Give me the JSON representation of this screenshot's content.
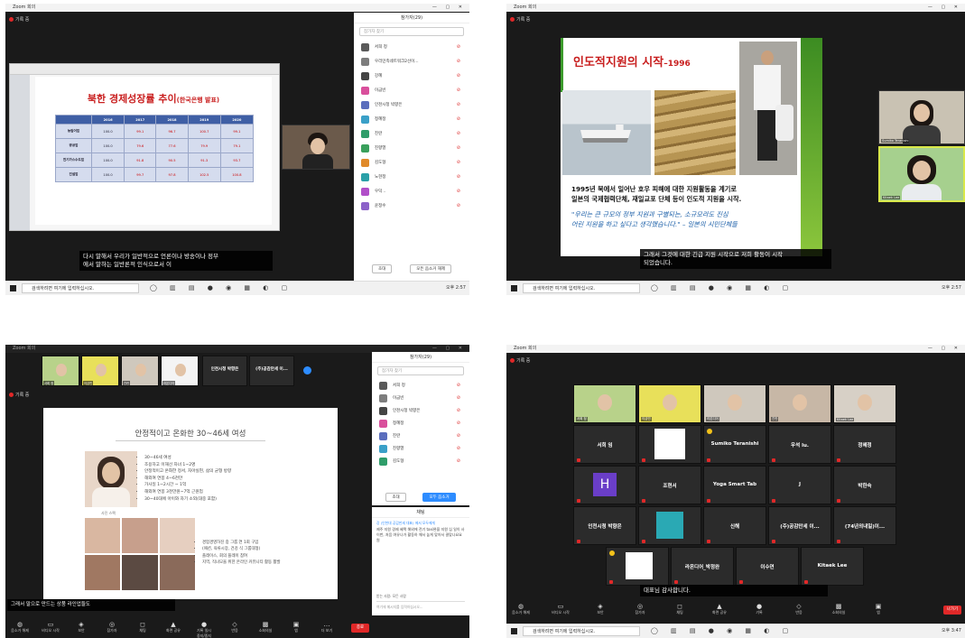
{
  "q1": {
    "app_title": "Zoom 회의",
    "recording": "기록 중",
    "slide_title": "북한 경제성장률 추이",
    "slide_title_suffix": "(한국은행 발표)",
    "table_headers": [
      "",
      "2016",
      "2017",
      "2018",
      "2019",
      "2020"
    ],
    "table_rows": [
      {
        "label": "농림어업",
        "values": [
          "100.0",
          "99.1",
          "96.7",
          "100.7",
          "99.1"
        ]
      },
      {
        "label": "광공업",
        "values": [
          "100.0",
          "79.6",
          "77.6",
          "79.9",
          "79.1"
        ]
      },
      {
        "label": "전기가스수도업",
        "values": [
          "100.0",
          "91.8",
          "90.5",
          "91.3",
          "93.7"
        ]
      },
      {
        "label": "건설업",
        "values": [
          "100.0",
          "99.7",
          "97.8",
          "102.5",
          "100.8"
        ]
      }
    ],
    "caption_line1": "다시 말해서 우리가 일반적으로 언론이나 방송이나 정부",
    "caption_line2": "에서 말하는 일반론적 인식으로서 이",
    "panel_title": "참가자(29)",
    "panel_search": "참가자 찾기",
    "participants": [
      "서희 정",
      "우리민족네트워크2선이...",
      "강혜",
      "이금빈",
      "인천시청 박향은",
      "정혜정",
      "진란",
      "진향열",
      "김도형",
      "노현정",
      "우덕 ..",
      "윤정수"
    ],
    "btn_invite": "초대",
    "btn_mute_all": "모든 음소거 해제",
    "taskbar_search": "검색하려면 여기에 입력하십시오.",
    "clock": "오후 2:57"
  },
  "q2": {
    "app_title": "Zoom 회의",
    "recording": "기록 중",
    "slide_title": "인도적지원의 시작",
    "slide_year": "–1996",
    "body_line1": "1995년 북에서 일어난 호우 피해에 대한 지원활동을 계기로",
    "body_line2": "일본의 국제협력단체, 재일교포 단체 등이 인도적 지원을 시작.",
    "quote_line1": "\"우리는 큰 규모의 정부 지원과 구별되는, 소규모라도 진심",
    "quote_line2": "어린 지원을 하고 싶다고 생각했습니다.\" – 일본의 시민단체들",
    "caption_line1": "그래서 그것에 대한 긴급 지원 시작으로 저희 활동이 시작",
    "caption_line2": "되었습니다.",
    "video1_name": "Sumiko Teranishi",
    "video2_name": "Kitaek Lee",
    "taskbar_search": "검색하려면 여기에 입력하십시오.",
    "clock": "오후 2:57"
  },
  "q3": {
    "app_title": "Zoom 회의",
    "recording": "기록 중",
    "top_videos": [
      "서희 정",
      "이금빈",
      "진란",
      "라온디어"
    ],
    "top_name_tiles": [
      "인천시청 박향은",
      "(주)공감만세 이..."
    ],
    "slide_title": "안정적이고 온화한 30~46세 여성",
    "bullets": [
      "30~46세 여성",
      "조용하고 이해선 자녀 1~2명",
      "안정적이고 온화한 정서, 자아실현, 삶의 균형 방향",
      "해외여 연봉 4~6천만",
      "가사일 1~2시간 ~ 1억",
      "해외여 연봉 3천만원~7억 근원업",
      "30~40대에 아이와 자기 소외(대중 포함)"
    ],
    "bullets2": [
      "경험경영하진 중 그룹 연 1회 구입",
      "(패션, 육류시장, 건강 식 그룹대형)",
      "플레이스, 회의 플레이 참여",
      "지역, 직녀모을 위한 온라인 커뮤니티 활동 활발"
    ],
    "photo_caption": "사진 스팩",
    "caption_line1": "그래서 말으로 만드는 상품 라인업들도",
    "panel_title": "참가자(29)",
    "panel_search": "참가자 찾기",
    "participants": [
      "서희 정",
      "이금빈",
      "인천시청 박향은",
      "정혜정",
      "진란",
      "진향열",
      "김도형"
    ],
    "btn_invite": "초대",
    "btn_mute_all": "모두 음소거",
    "chat_title": "채팅",
    "chat_sender": "강 (인천대 공감만세 대표) 에서 모두에게",
    "chat_msg": "제주 지원 경제 혜택 해외에 전기 taxi완을 지원 심 일이 사 이번, 처음 여유나가 활동하 해서 높게 맞아서 결맞나요요 원",
    "chat_to": "받는 사람: 모든 사람",
    "chat_placeholder": "여기에 메시지를 입력하십시오...",
    "toolbar": [
      "음소거 해제",
      "비디오 시작",
      "보안",
      "참가자",
      "채팅",
      "화면 공유",
      "기록 일시 중지/중지",
      "반응",
      "소회의실",
      "앱",
      "더 보기"
    ],
    "end_label": "종료"
  },
  "q4": {
    "app_title": "Zoom 회의",
    "recording": "기록 중",
    "row1": [
      "서희 정",
      "이금빈",
      "라온디어",
      "진란",
      "Kitaek Lee"
    ],
    "tiles_row2": [
      "서희 임",
      "",
      "Sumiko Teranishi",
      "우석 lu.",
      "정혜정"
    ],
    "tiles_row3": [
      "",
      "조현서",
      "Yoga Smart Tab",
      "J",
      "박한숙"
    ],
    "tiles_row4": [
      "인천시청 박향은",
      "",
      "신해",
      "(주)공감만세 이...",
      "(74년의내일)이..."
    ],
    "tiles_row5": [
      "",
      "라온디어_박정완",
      "이수연",
      "Kitaek Lee"
    ],
    "h_initial": "H",
    "caption": "대표님 감사합니다.",
    "toolbar": [
      "음소거 해제",
      "비디오 시작",
      "보안",
      "참가자",
      "채팅",
      "화면 공유",
      "기록",
      "반응",
      "소회의실",
      "앱"
    ],
    "end_label": "나가기",
    "taskbar_search": "검색하려면 여기에 입력하십시오.",
    "clock": "오후 3:47"
  }
}
